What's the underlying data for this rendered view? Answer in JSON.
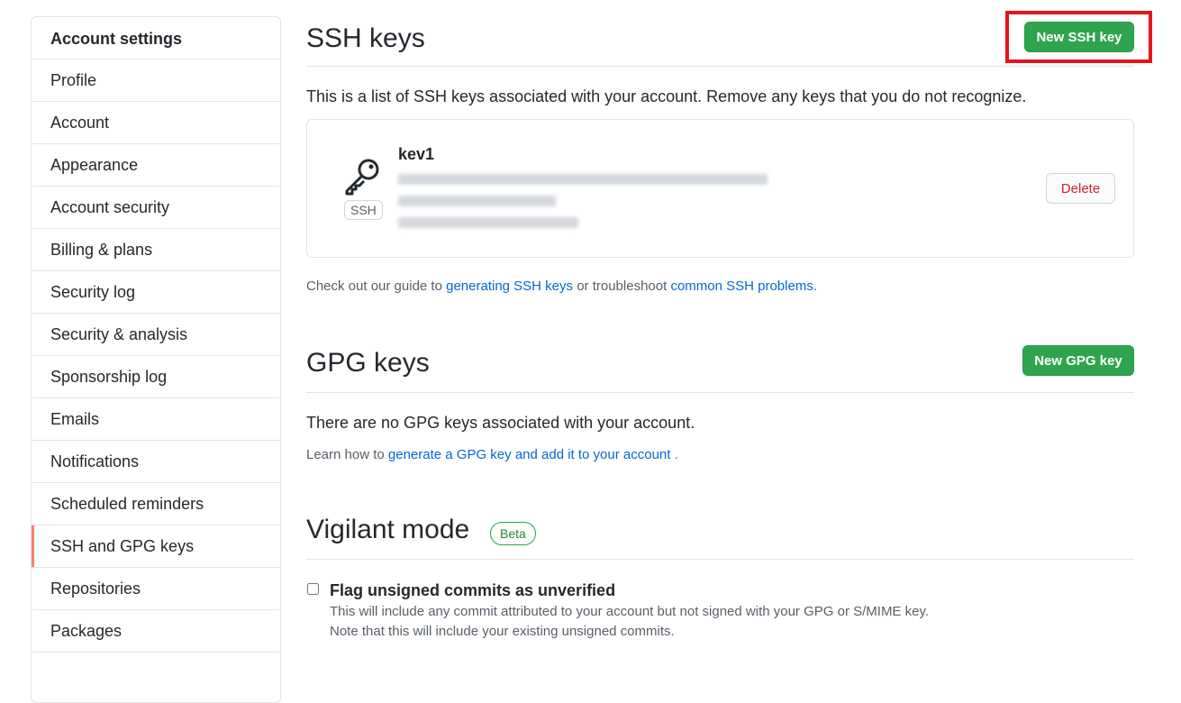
{
  "sidebar": {
    "heading": "Account settings",
    "items": [
      {
        "label": "Profile"
      },
      {
        "label": "Account"
      },
      {
        "label": "Appearance"
      },
      {
        "label": "Account security"
      },
      {
        "label": "Billing & plans"
      },
      {
        "label": "Security log"
      },
      {
        "label": "Security & analysis"
      },
      {
        "label": "Sponsorship log"
      },
      {
        "label": "Emails"
      },
      {
        "label": "Notifications"
      },
      {
        "label": "Scheduled reminders"
      },
      {
        "label": "SSH and GPG keys",
        "selected": true
      },
      {
        "label": "Repositories"
      },
      {
        "label": "Packages"
      }
    ]
  },
  "ssh": {
    "title": "SSH keys",
    "new_button": "New SSH key",
    "description": "This is a list of SSH keys associated with your account. Remove any keys that you do not recognize.",
    "key": {
      "title": "kev1",
      "badge": "SSH",
      "delete_label": "Delete"
    },
    "guide_prefix": "Check out our guide to ",
    "guide_link1": "generating SSH keys",
    "guide_middle": " or troubleshoot ",
    "guide_link2": "common SSH problems",
    "guide_suffix": "."
  },
  "gpg": {
    "title": "GPG keys",
    "new_button": "New GPG key",
    "empty_text": "There are no GPG keys associated with your account.",
    "learn_prefix": "Learn how to ",
    "learn_link": "generate a GPG key and add it to your account",
    "learn_suffix": " ."
  },
  "vigilant": {
    "title": "Vigilant mode",
    "badge": "Beta",
    "checkbox_label": "Flag unsigned commits as unverified",
    "note1": "This will include any commit attributed to your account but not signed with your GPG or S/MIME key.",
    "note2": "Note that this will include your existing unsigned commits."
  },
  "colors": {
    "primary_green": "#2ea44f",
    "link_blue": "#0366d6",
    "danger_red": "#cb2431",
    "highlight_red": "#e5151d",
    "selected_accent": "#f9826c"
  }
}
